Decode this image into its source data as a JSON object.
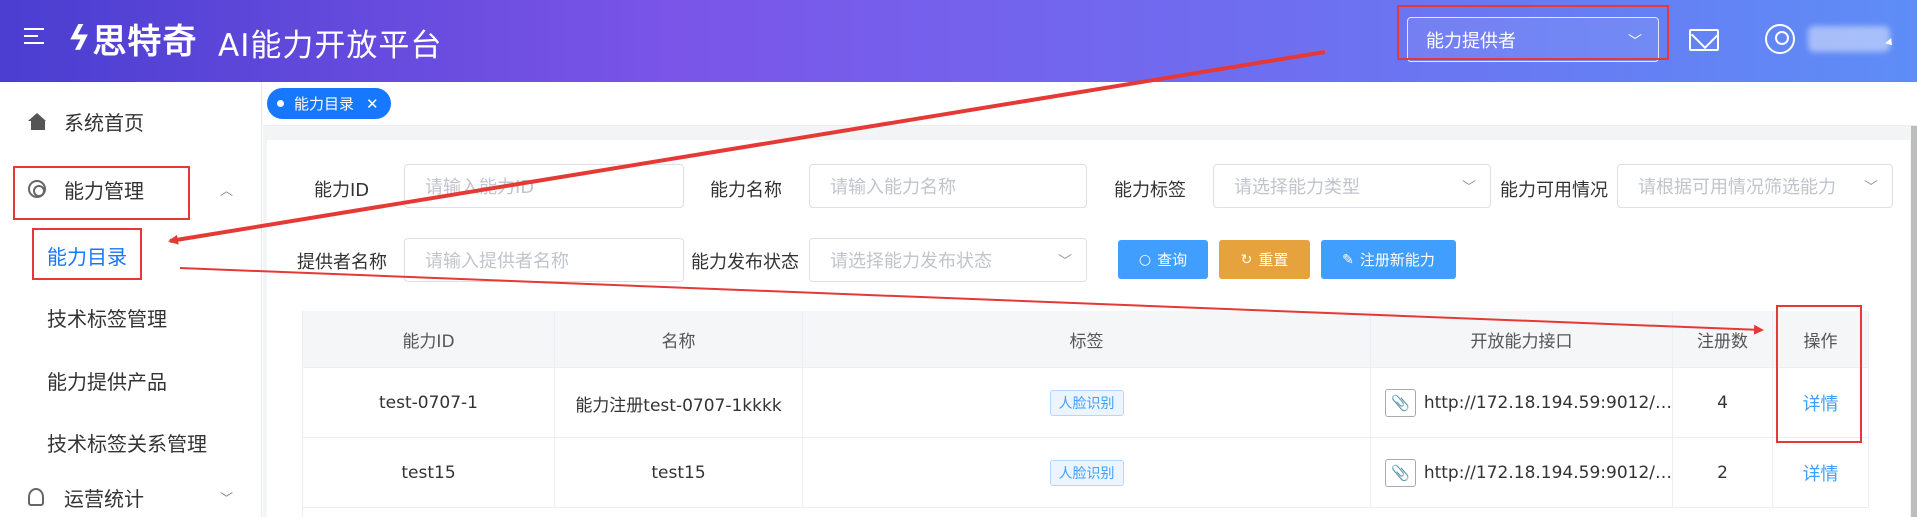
{
  "header": {
    "logo_mark": "ϟ",
    "logo_text": "思特奇",
    "platform_title": "AI能力开放平台",
    "role_select_value": "能力提供者"
  },
  "sidebar": {
    "items": [
      {
        "label": "系统首页"
      },
      {
        "label": "能力管理"
      },
      {
        "label": "能力目录"
      },
      {
        "label": "技术标签管理"
      },
      {
        "label": "能力提供产品"
      },
      {
        "label": "技术标签关系管理"
      },
      {
        "label": "运营统计"
      }
    ]
  },
  "tabs": [
    {
      "label": "能力目录"
    }
  ],
  "filters": {
    "ability_id": {
      "label": "能力ID",
      "placeholder": "请输入能力ID"
    },
    "ability_name": {
      "label": "能力名称",
      "placeholder": "请输入能力名称"
    },
    "ability_tag": {
      "label": "能力标签",
      "placeholder": "请选择能力类型"
    },
    "availability": {
      "label": "能力可用情况",
      "placeholder": "请根据可用情况筛选能力"
    },
    "provider_name": {
      "label": "提供者名称",
      "placeholder": "请输入提供者名称"
    },
    "publish_status": {
      "label": "能力发布状态",
      "placeholder": "请选择能力发布状态"
    }
  },
  "buttons": {
    "query": "查询",
    "reset": "重置",
    "register": "注册新能力"
  },
  "table": {
    "columns": [
      "能力ID",
      "名称",
      "标签",
      "开放能力接口",
      "注册数",
      "操作"
    ],
    "rows": [
      {
        "id": "test-0707-1",
        "name": "能力注册test-0707-1kkkk",
        "tag": "人脸识别",
        "api": "http://172.18.194.59:9012/…",
        "count": "4",
        "action": "详情"
      },
      {
        "id": "test15",
        "name": "test15",
        "tag": "人脸识别",
        "api": "http://172.18.194.59:9012/…",
        "count": "2",
        "action": "详情"
      }
    ]
  },
  "colors": {
    "accent": "#1677ff",
    "link": "#409eff",
    "reset_button": "#e6a23c",
    "annotation": "#e53935"
  }
}
